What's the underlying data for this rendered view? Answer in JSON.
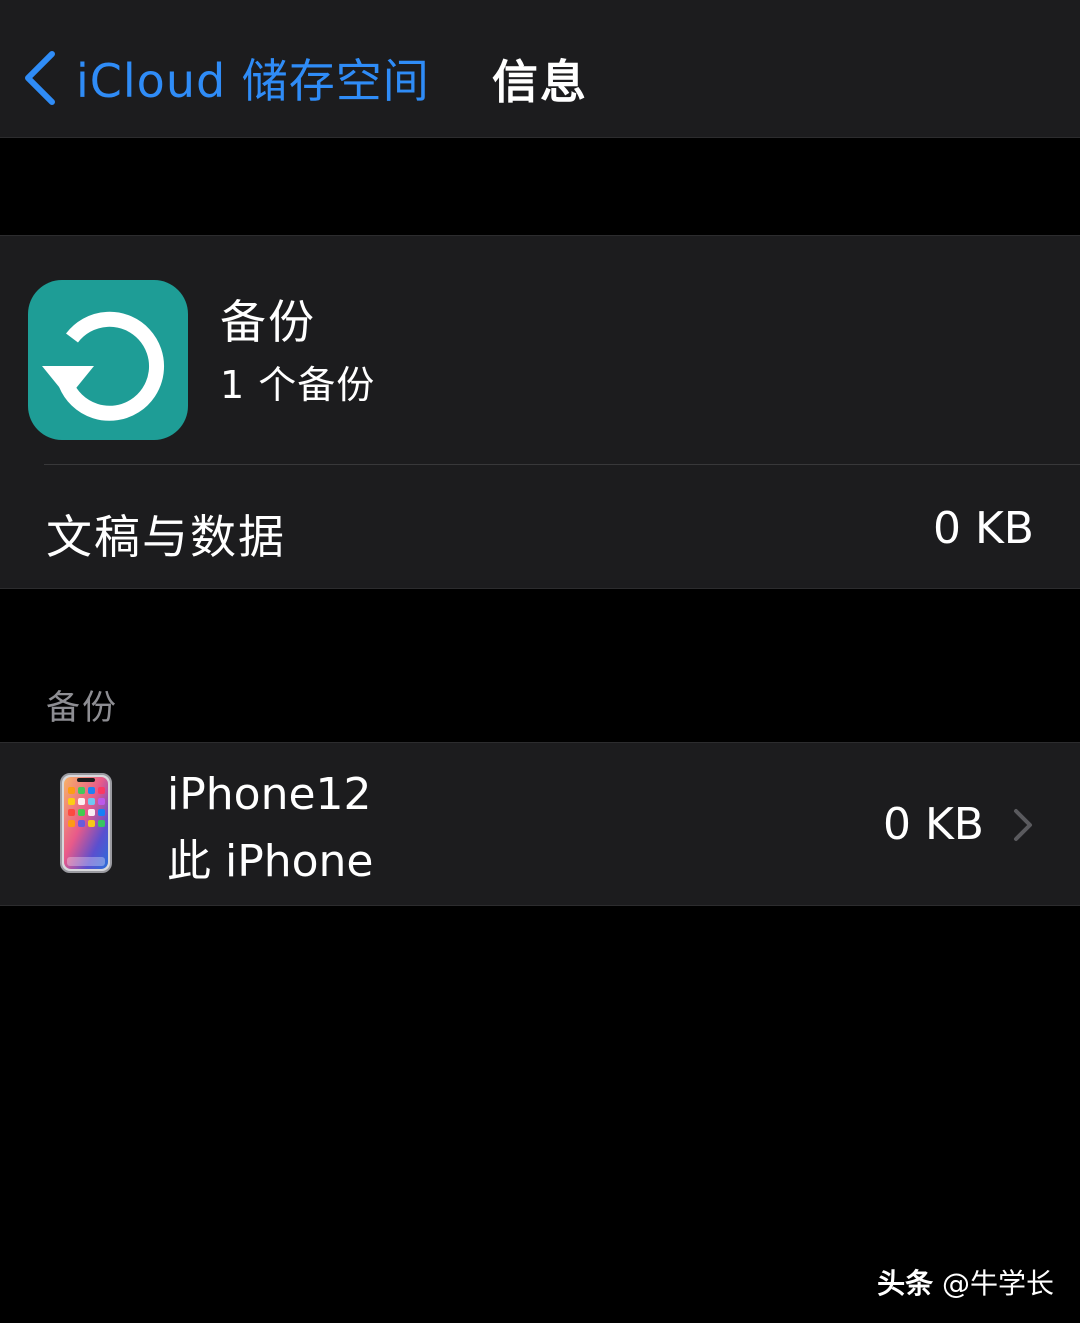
{
  "colors": {
    "accent": "#2f8cf7",
    "app_icon_bg": "#1e9d96",
    "group_bg": "#1c1c1e",
    "page_bg": "#000000",
    "secondary_text": "#8e8e93"
  },
  "navbar": {
    "back_label": "iCloud 储存空间",
    "back_icon": "chevron-left-icon",
    "title": "信息"
  },
  "app_summary": {
    "icon": "backup-restore-icon",
    "title": "备份",
    "subtitle": "1 个备份"
  },
  "documents_row": {
    "label": "文稿与数据",
    "size": "0 KB"
  },
  "backups_section": {
    "header": "备份",
    "items": [
      {
        "icon": "iphone-icon",
        "name": "iPhone12",
        "subtitle": "此 iPhone",
        "size": "0 KB",
        "accessory": "chevron-right-icon"
      }
    ]
  },
  "watermark": {
    "brand": "头条",
    "handle": "@牛学长"
  }
}
